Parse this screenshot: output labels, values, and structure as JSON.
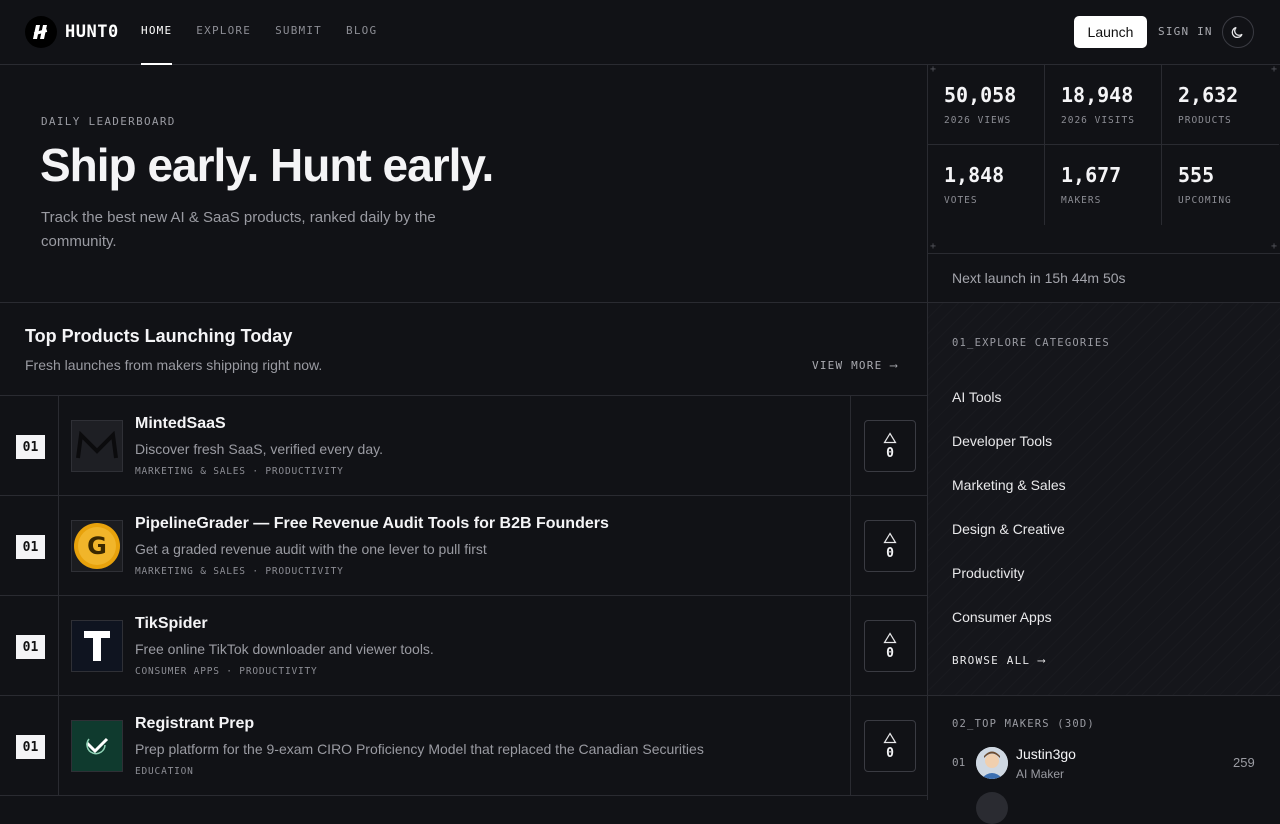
{
  "brand": {
    "name": "HUNT0"
  },
  "nav": {
    "items": [
      "HOME",
      "EXPLORE",
      "SUBMIT",
      "BLOG"
    ],
    "active": "HOME"
  },
  "header": {
    "launch_label": "Launch",
    "signin_label": "SIGN IN",
    "theme_icon": "moon-icon"
  },
  "hero": {
    "eyebrow": "DAILY LEADERBOARD",
    "title": "Ship early. Hunt early.",
    "subtitle": "Track the best new AI & SaaS products, ranked daily by the community."
  },
  "stats": [
    {
      "value": "50,058",
      "label": "2026 VIEWS"
    },
    {
      "value": "18,948",
      "label": "2026 VISITS"
    },
    {
      "value": "2,632",
      "label": "PRODUCTS"
    },
    {
      "value": "1,848",
      "label": "VOTES"
    },
    {
      "value": "1,677",
      "label": "MAKERS"
    },
    {
      "value": "555",
      "label": "UPCOMING"
    }
  ],
  "next_launch": "Next launch in 15h 44m 50s",
  "products_section": {
    "title": "Top Products Launching Today",
    "subtitle": "Fresh launches from makers shipping right now.",
    "view_more": "VIEW MORE ⟶",
    "items": [
      {
        "rank": "01",
        "name": "MintedSaaS",
        "desc": "Discover fresh SaaS, verified every day.",
        "tags": "MARKETING & SALES · PRODUCTIVITY",
        "votes": "0"
      },
      {
        "rank": "01",
        "name": "PipelineGrader — Free Revenue Audit Tools for B2B Founders",
        "desc": "Get a graded revenue audit with the one lever to pull first",
        "tags": "MARKETING & SALES · PRODUCTIVITY",
        "votes": "0"
      },
      {
        "rank": "01",
        "name": "TikSpider",
        "desc": "Free online TikTok downloader and viewer tools.",
        "tags": "CONSUMER APPS · PRODUCTIVITY",
        "votes": "0"
      },
      {
        "rank": "01",
        "name": "Registrant Prep",
        "desc": "Prep platform for the 9-exam CIRO Proficiency Model that replaced the Canadian Securities",
        "tags": "EDUCATION",
        "votes": "0"
      }
    ]
  },
  "categories": {
    "heading": "01_EXPLORE CATEGORIES",
    "items": [
      "AI Tools",
      "Developer Tools",
      "Marketing & Sales",
      "Design & Creative",
      "Productivity",
      "Consumer Apps"
    ],
    "browse_all": "BROWSE ALL ⟶"
  },
  "makers": {
    "heading": "02_TOP MAKERS (30D)",
    "items": [
      {
        "rank": "01",
        "name": "Justin3go",
        "role": "AI Maker",
        "score": "259"
      }
    ]
  }
}
